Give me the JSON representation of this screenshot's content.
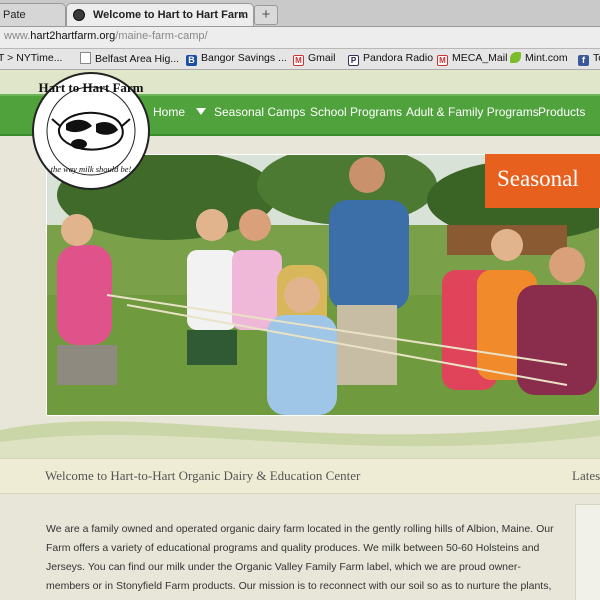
{
  "browser": {
    "tabs": [
      {
        "title": "Pate"
      },
      {
        "title": "Welcome to Hart to Hart Farm"
      }
    ],
    "tab_close_symbol": "×",
    "new_tab_symbol": "+",
    "address": {
      "prefix": "www.",
      "host": "hart2hartfarm.org",
      "path": "/maine-farm-camp/"
    },
    "bookmarks": [
      {
        "label": "T > NYTime...",
        "icon": "nyt-icon"
      },
      {
        "label": "Belfast Area Hig...",
        "icon": "page-icon"
      },
      {
        "label": "Bangor Savings ...",
        "icon": "bangor-b-icon"
      },
      {
        "label": "Gmail",
        "icon": "gmail-icon"
      },
      {
        "label": "Pandora Radio",
        "icon": "pandora-p-icon"
      },
      {
        "label": "MECA_Mail",
        "icon": "gmail-icon"
      },
      {
        "label": "Mint.com",
        "icon": "mint-leaf-icon"
      },
      {
        "label": "Tc",
        "icon": "facebook-icon"
      }
    ]
  },
  "site": {
    "logo": {
      "title": "Hart to Hart Farm",
      "tagline": "the way milk should be!"
    },
    "nav": [
      {
        "label": "Home",
        "has_dropdown": false
      },
      {
        "label": "Seasonal Camps",
        "has_dropdown": true
      },
      {
        "label": "School Programs",
        "has_dropdown": false
      },
      {
        "label": "Adult & Family Programs",
        "has_dropdown": false
      },
      {
        "label": "Products",
        "has_dropdown": false
      }
    ],
    "hero_banner": "Seasonal",
    "welcome_heading": "Welcome to Hart-to-Hart Organic Dairy & Education Center",
    "sidebar_heading": "Lates",
    "intro_paragraph": "We are a family owned and operated organic dairy farm located in the gently rolling hills of Albion, Maine. Our Farm offers a variety of educational programs and quality produces. We milk between 50-60 Holsteins and Jerseys. You can find our milk under the Organic Valley Family Farm label, which we are proud owner-members or in Stonyfield Farm products. Our mission is to reconnect with our soil so as to nurture the plants, animals and the people who feed from"
  },
  "colors": {
    "nav_green": "#4fa23c",
    "banner_orange": "#e8601e"
  }
}
